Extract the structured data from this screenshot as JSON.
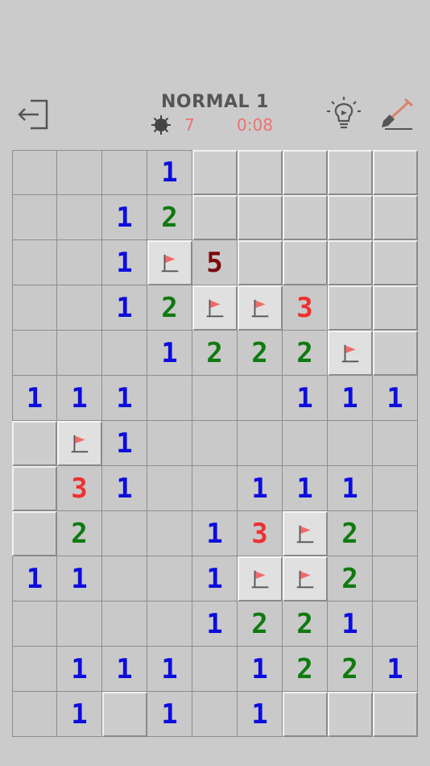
{
  "header": {
    "title": "NORMAL  1",
    "mine_count": "7",
    "timer": "0:08"
  },
  "colors": {
    "1": "#0d0ddd",
    "2": "#0f7a0f",
    "3": "#ee3030",
    "5": "#7a0a0a",
    "flag": "#f06a6a"
  },
  "board": {
    "rows": [
      [
        "",
        "",
        "",
        "1",
        "#",
        "#",
        "#",
        "#",
        "#"
      ],
      [
        "",
        "",
        "1",
        "2",
        "#",
        "#",
        "#",
        "#",
        "#"
      ],
      [
        "",
        "",
        "1",
        "F",
        "5",
        "#",
        "#",
        "#",
        "#"
      ],
      [
        "",
        "",
        "1",
        "2",
        "F",
        "F",
        "3",
        "#",
        "#"
      ],
      [
        "",
        "",
        "",
        "1",
        "2",
        "2",
        "2",
        "F",
        "#"
      ],
      [
        "1",
        "1",
        "1",
        "",
        "",
        "",
        "1",
        "1",
        "1"
      ],
      [
        "#",
        "F",
        "1",
        "",
        "",
        "",
        "",
        "",
        ""
      ],
      [
        "#",
        "3",
        "1",
        "",
        "",
        "1",
        "1",
        "1",
        ""
      ],
      [
        "#",
        "2",
        "",
        "",
        "1",
        "3",
        "F",
        "2",
        ""
      ],
      [
        "1",
        "1",
        "",
        "",
        "1",
        "F",
        "F",
        "2",
        ""
      ],
      [
        "",
        "",
        "",
        "",
        "1",
        "2",
        "2",
        "1",
        ""
      ],
      [
        "",
        "1",
        "1",
        "1",
        "",
        "1",
        "2",
        "2",
        "1"
      ],
      [
        "",
        "1",
        "#",
        "1",
        "",
        "1",
        "#",
        "#",
        "#"
      ]
    ]
  }
}
